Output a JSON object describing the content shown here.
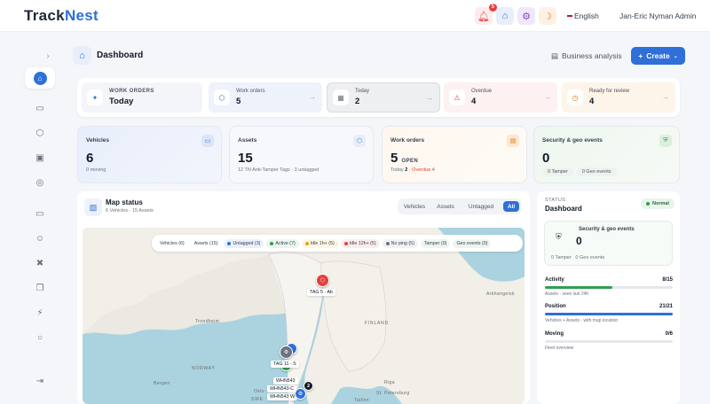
{
  "app": {
    "brand_a": "Track",
    "brand_b": "Nest"
  },
  "topbar": {
    "notification_count": "5",
    "language": "English",
    "user": "Jan-Eric Nyman Admin"
  },
  "page": {
    "title": "Dashboard",
    "business_analysis": "Business analysis",
    "create_label": "Create"
  },
  "work_orders": {
    "header_label": "WORK ORDERS",
    "header_value": "Today",
    "cards": [
      {
        "label": "Work orders",
        "value": "5"
      },
      {
        "label": "Today",
        "value": "2"
      },
      {
        "label": "Overdue",
        "value": "4"
      },
      {
        "label": "Ready for review",
        "value": "4"
      }
    ]
  },
  "stats": {
    "vehicles": {
      "label": "Vehicles",
      "value": "6",
      "sub": "0 moving"
    },
    "assets": {
      "label": "Assets",
      "value": "15",
      "sub": "12 TN Anti-Tamper Tags · 3 untagged"
    },
    "work_orders": {
      "label": "Work orders",
      "value": "5",
      "open": "OPEN",
      "today": "Today",
      "today_val": "2",
      "overdue": "Overdue 4"
    },
    "security": {
      "label": "Security & geo events",
      "value": "0",
      "pill_a": "0 Tamper",
      "pill_b": "0 Geo events"
    }
  },
  "map_status": {
    "title": "Map status",
    "subtitle": "6 Vehicles · 15 Assets",
    "segments": [
      "Vehicles",
      "Assets",
      "Untagged",
      "All"
    ],
    "active_segment": "All",
    "filters": [
      {
        "label": "Vehicles (6)",
        "color": ""
      },
      {
        "label": "Assets (15)",
        "color": ""
      },
      {
        "label": "Untagged (3)",
        "color": "#2f6fd8"
      },
      {
        "label": "Active (7)",
        "color": "#2e9e4f"
      },
      {
        "label": "Idle 1h+ (5)",
        "color": "#e0a800"
      },
      {
        "label": "Idle 12h+ (5)",
        "color": "#e53e3e"
      },
      {
        "label": "No ping (5)",
        "color": "#6b7280"
      },
      {
        "label": "Tamper (0)",
        "color": ""
      },
      {
        "label": "Geo events (0)",
        "color": ""
      }
    ],
    "places": [
      "Arkhangelsk",
      "Trondheim",
      "FINLAND",
      "NORWAY",
      "Bergen",
      "Oslo",
      "St. Petersburg",
      "Tallinn",
      "Riga",
      "SWE"
    ],
    "markers": [
      "TAG 5 - Ab",
      "TAG 11 - S",
      "WHN543",
      "WHN543-C",
      "WHN543 W"
    ],
    "cluster_count": "2"
  },
  "status_panel": {
    "caption": "STATUS",
    "title": "Dashboard",
    "badge": "Normal",
    "security_title": "Security & geo events",
    "security_value": "0",
    "tamper": "0 Tamper",
    "geo": "0 Geo events",
    "metrics": [
      {
        "label": "Activity",
        "value": "8/15",
        "note": "Assets · seen last 24h",
        "fraction": 0.53,
        "color": "#2e9e4f"
      },
      {
        "label": "Position",
        "value": "21/21",
        "note": "Vehicles + Assets · with map location",
        "fraction": 1.0,
        "color": "#2f6fd8"
      },
      {
        "label": "Moving",
        "value": "0/6",
        "note": "Fleet overview",
        "fraction": 0.0,
        "color": "#2f6fd8"
      }
    ]
  }
}
